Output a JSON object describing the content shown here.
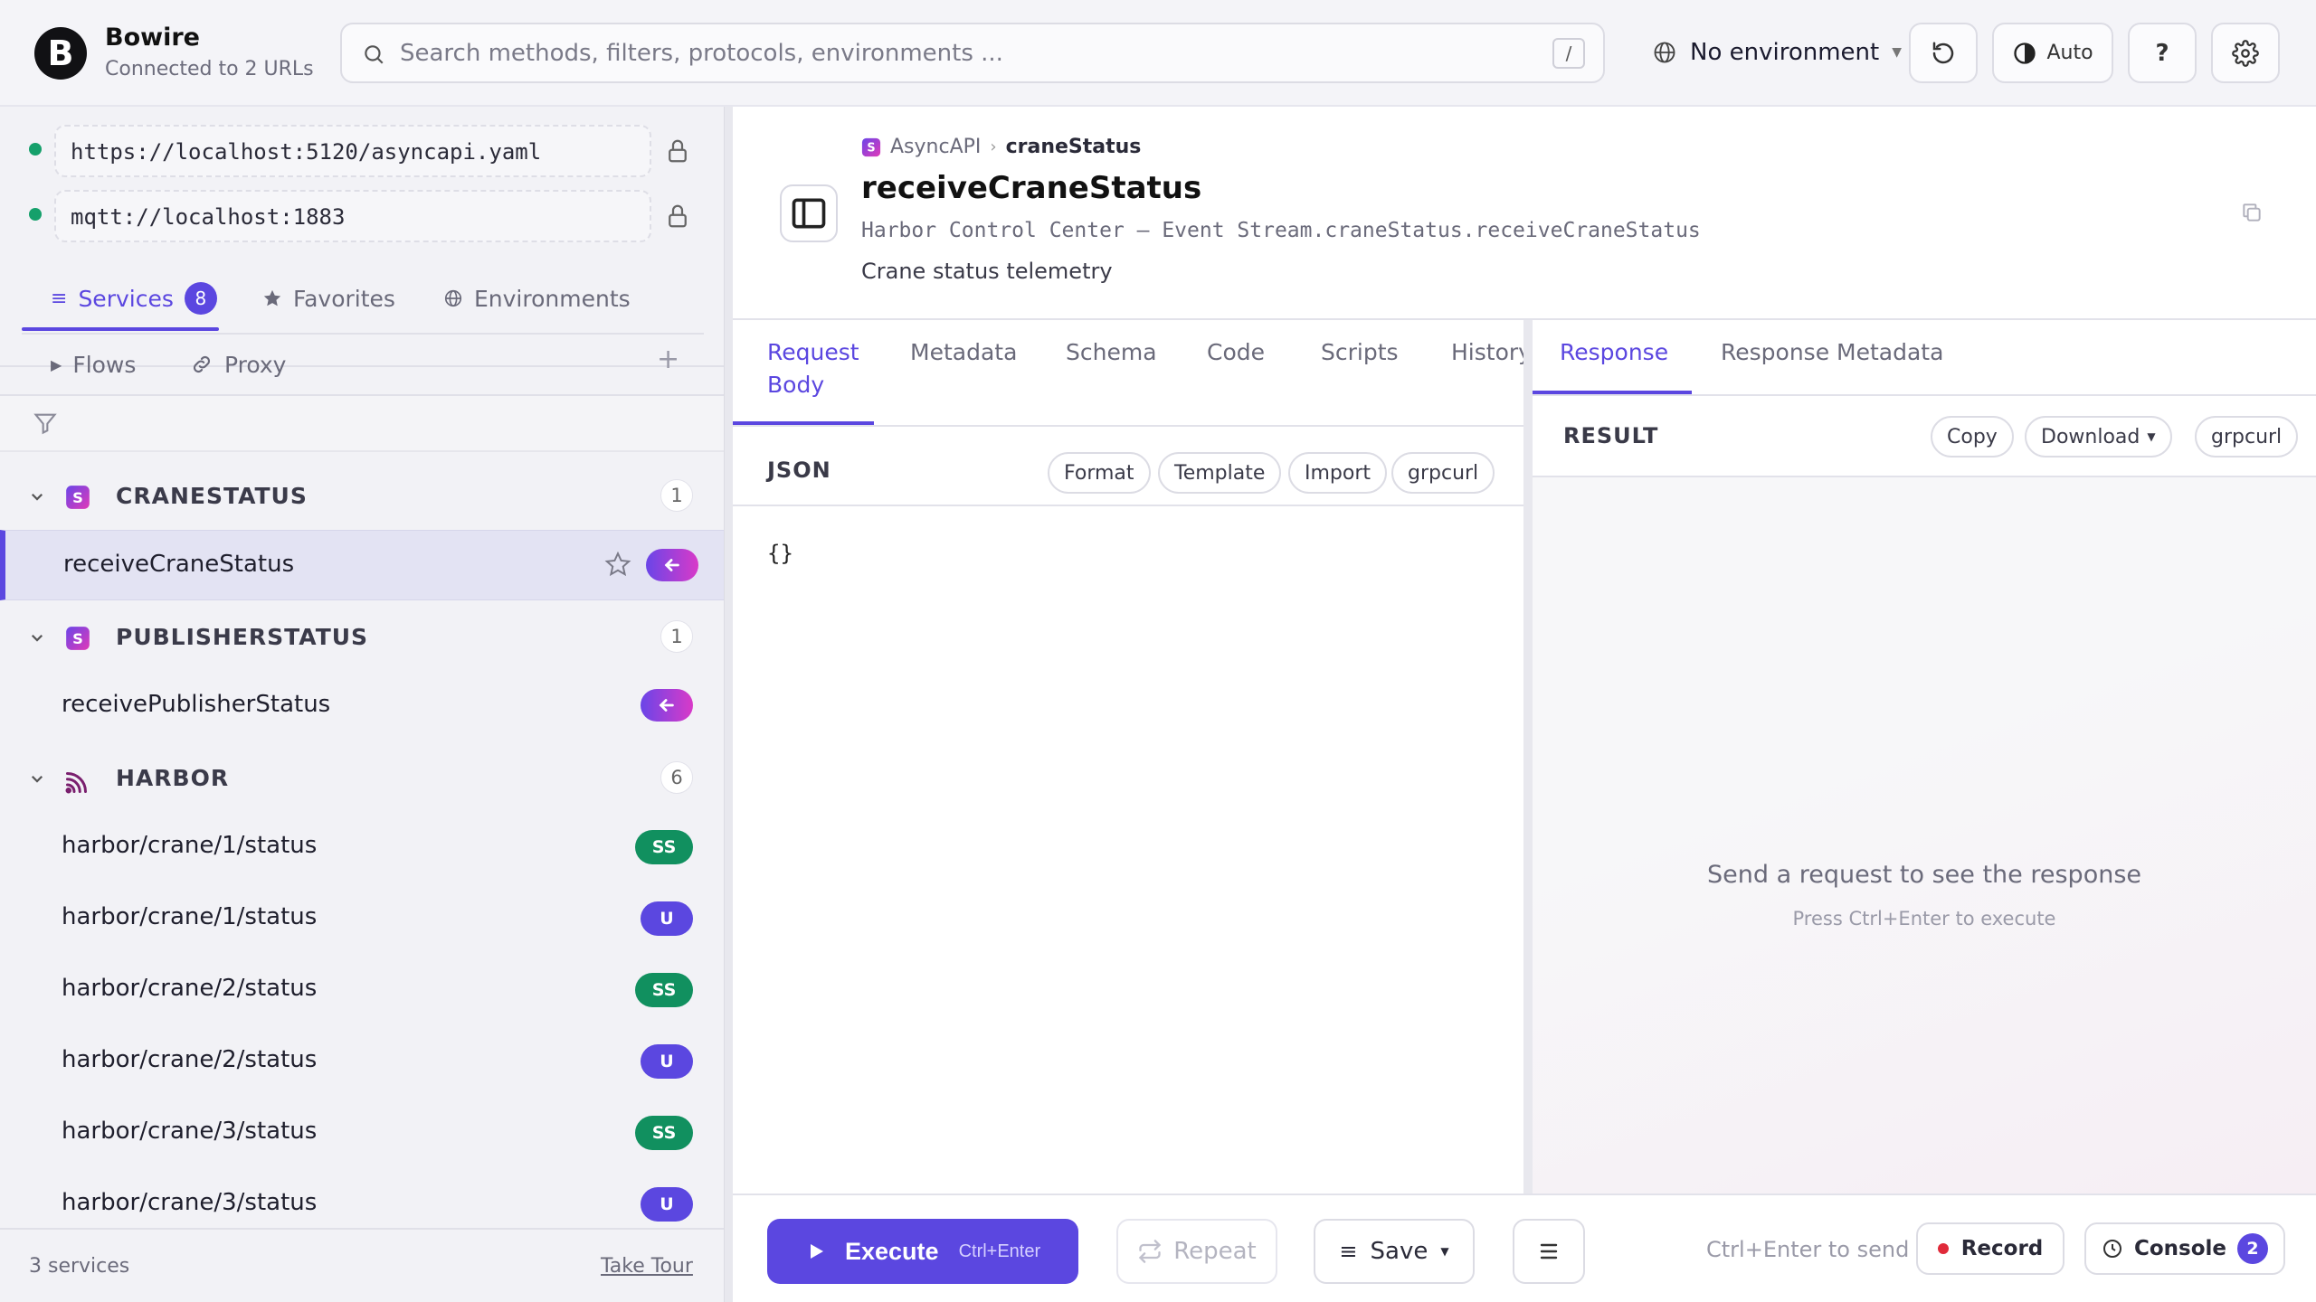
{
  "app": {
    "title": "Bowire",
    "subtitle": "Connected to 2 URLs",
    "logo_letter": "B"
  },
  "search": {
    "placeholder": "Search methods, filters, protocols, environments ...",
    "shortcut": "/"
  },
  "header": {
    "environment": "No environment",
    "theme_label": "Auto",
    "help_label": "?"
  },
  "sidebar": {
    "urls": [
      {
        "url": "https://localhost:5120/asyncapi.yaml",
        "status_color": "#15a06b"
      },
      {
        "url": "mqtt://localhost:1883",
        "status_color": "#15a06b"
      }
    ],
    "tabs": {
      "services": "Services",
      "services_count": "8",
      "favorites": "Favorites",
      "environments": "Environments"
    },
    "subtabs": {
      "flows": "Flows",
      "proxy": "Proxy",
      "add": "+"
    },
    "groups": [
      {
        "name": "CRANESTATUS",
        "count": "1",
        "icon": "asyncapi-icon",
        "methods": [
          {
            "label": "receiveCraneStatus",
            "badge": "receive",
            "selected": true
          }
        ]
      },
      {
        "name": "PUBLISHERSTATUS",
        "count": "1",
        "icon": "asyncapi-icon",
        "methods": [
          {
            "label": "receivePublisherStatus",
            "badge": "receive"
          }
        ]
      },
      {
        "name": "HARBOR",
        "count": "6",
        "icon": "mqtt-icon",
        "methods": [
          {
            "label": "harbor/crane/1/status",
            "badge": "SS"
          },
          {
            "label": "harbor/crane/1/status",
            "badge": "U"
          },
          {
            "label": "harbor/crane/2/status",
            "badge": "SS"
          },
          {
            "label": "harbor/crane/2/status",
            "badge": "U"
          },
          {
            "label": "harbor/crane/3/status",
            "badge": "SS"
          },
          {
            "label": "harbor/crane/3/status",
            "badge": "U"
          }
        ]
      }
    ],
    "footer": {
      "count": "3 services",
      "tour": "Take Tour"
    }
  },
  "detail": {
    "breadcrumb": {
      "protocol": "AsyncAPI",
      "service": "craneStatus"
    },
    "title": "receiveCraneStatus",
    "path": "Harbor Control Center – Event Stream.craneStatus.receiveCraneStatus",
    "description": "Crane status telemetry"
  },
  "request": {
    "tabs": [
      "Request\nBody",
      "Metadata",
      "Schema",
      "Code",
      "Scripts",
      "History"
    ],
    "tab_request_line1": "Request",
    "tab_request_line2": "Body",
    "format_label": "JSON",
    "buttons": {
      "format": "Format",
      "template": "Template",
      "import": "Import",
      "grpcurl": "grpcurl"
    },
    "body": "{}"
  },
  "response": {
    "tabs": {
      "response": "Response",
      "metadata": "Response Metadata"
    },
    "result_label": "RESULT",
    "buttons": {
      "copy": "Copy",
      "download": "Download",
      "grpcurl": "grpcurl"
    },
    "empty_title": "Send a request to see the response",
    "empty_hint": "Press Ctrl+Enter to execute"
  },
  "actions": {
    "execute": "Execute",
    "execute_shortcut": "Ctrl+Enter",
    "repeat": "Repeat",
    "save": "Save",
    "send_hint": "Ctrl+Enter to send",
    "record": "Record",
    "console": "Console",
    "console_count": "2"
  },
  "colors": {
    "accent": "#5b47e0",
    "success": "#11905f",
    "record": "#e02a3a"
  }
}
